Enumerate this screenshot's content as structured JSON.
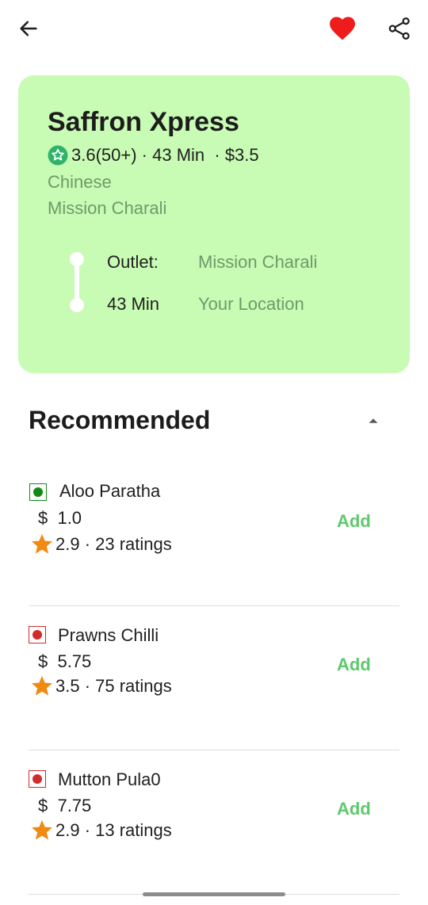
{
  "header": {
    "back_icon": "arrow-left-icon",
    "favorite_icon": "heart-icon",
    "favorite_color": "#ee1c1c",
    "share_icon": "share-icon"
  },
  "restaurant": {
    "name": "Saffron Xpress",
    "rating": "3.6(50+)",
    "time": " · 43 Min ",
    "cost": " · $3.5",
    "cuisine": "Chinese",
    "area": "Mission Charali",
    "card_color": "#c8fbb4",
    "route": {
      "outlet_label": "Outlet:",
      "outlet_value": "Mission Charali",
      "time_label": "43 Min",
      "destination": "Your Location"
    }
  },
  "section": {
    "title": "Recommended",
    "toggle_icon": "caret-up-icon"
  },
  "items": [
    {
      "name": "Aloo Paratha",
      "price": "$  1.0",
      "rating": "2.9 · 23 ratings",
      "type": "veg",
      "add_label": "Add"
    },
    {
      "name": "Prawns Chilli",
      "price": "$  5.75",
      "rating": "3.5 · 75 ratings",
      "type": "non-veg",
      "add_label": "Add"
    },
    {
      "name": "Mutton Pula0",
      "price": "$  7.75",
      "rating": "2.9 · 13 ratings",
      "type": "non-veg",
      "add_label": "Add"
    }
  ],
  "colors": {
    "veg": "#138a13",
    "non_veg": "#d22b2b",
    "add": "#5ec96b",
    "star": "#f08a12"
  }
}
